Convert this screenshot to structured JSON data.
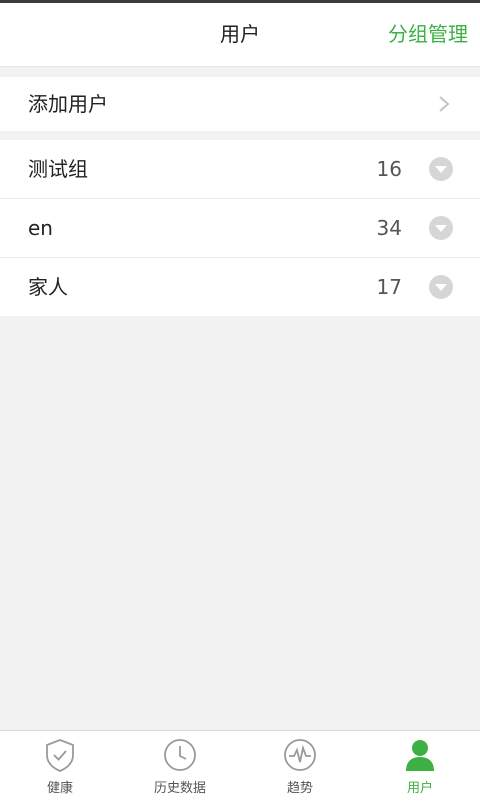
{
  "header": {
    "title": "用户",
    "manage_label": "分组管理"
  },
  "add_user": {
    "label": "添加用户"
  },
  "groups": [
    {
      "name": "测试组",
      "count": "16"
    },
    {
      "name": "en",
      "count": "34"
    },
    {
      "name": "家人",
      "count": "17"
    }
  ],
  "tabs": [
    {
      "label": "健康",
      "icon": "shield-check-icon"
    },
    {
      "label": "历史数据",
      "icon": "clock-icon"
    },
    {
      "label": "趋势",
      "icon": "pulse-icon"
    },
    {
      "label": "用户",
      "icon": "user-icon"
    }
  ],
  "colors": {
    "accent": "#3cb043",
    "background": "#f2f2f2",
    "toggle": "#d6d6d6"
  }
}
